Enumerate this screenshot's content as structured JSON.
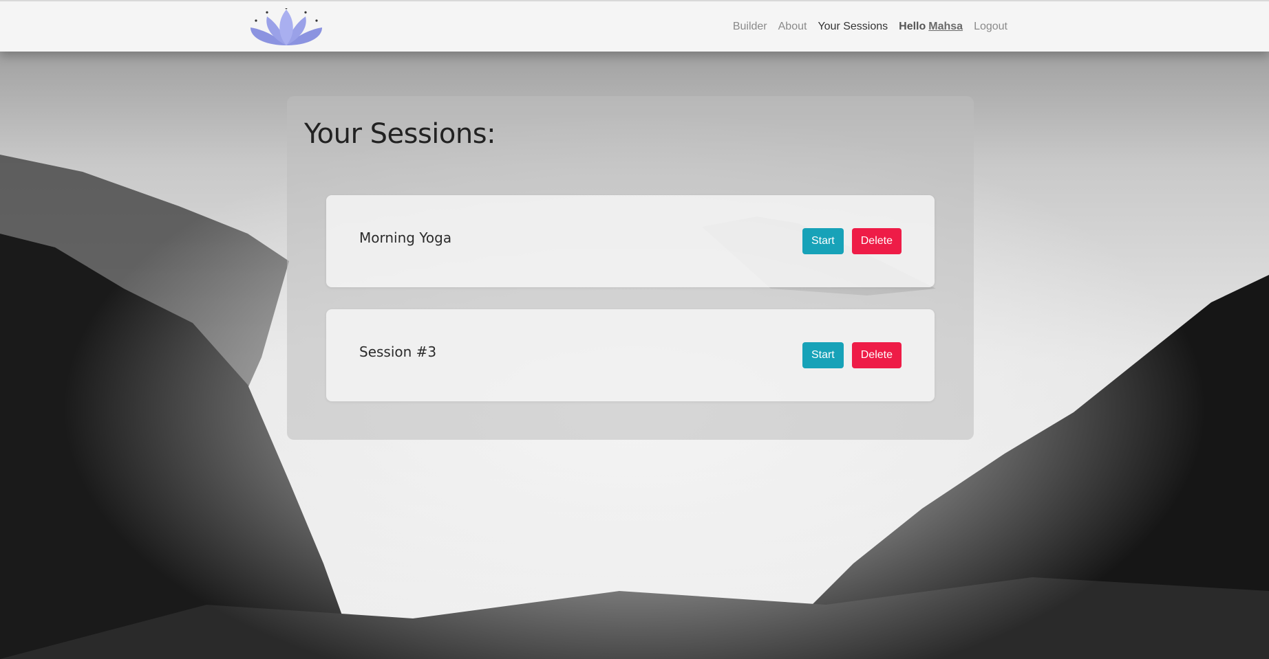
{
  "nav": {
    "links": [
      "Builder",
      "About",
      "Your Sessions"
    ],
    "hello_label": "Hello",
    "username": "Mahsa",
    "logout_label": "Logout"
  },
  "page": {
    "title": "Your Sessions:"
  },
  "sessions": [
    {
      "name": "Morning Yoga",
      "start_label": "Start",
      "delete_label": "Delete"
    },
    {
      "name": "Session #3",
      "start_label": "Start",
      "delete_label": "Delete"
    }
  ],
  "colors": {
    "start": "#17a2b8",
    "delete": "#ee1c47",
    "logo": "#8b93e0"
  }
}
